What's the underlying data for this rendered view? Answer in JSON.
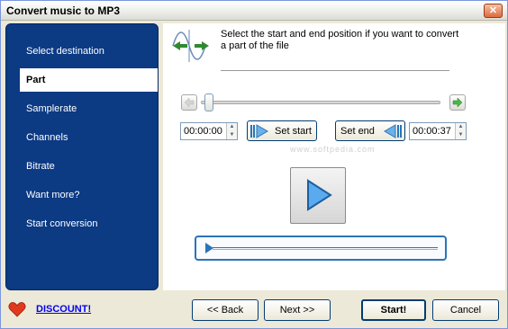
{
  "window": {
    "title": "Convert music to MP3",
    "close_label": "✕"
  },
  "sidebar": {
    "items": [
      {
        "label": "Select destination",
        "active": false
      },
      {
        "label": "Part",
        "active": true
      },
      {
        "label": "Samplerate",
        "active": false
      },
      {
        "label": "Channels",
        "active": false
      },
      {
        "label": "Bitrate",
        "active": false
      },
      {
        "label": "Want more?",
        "active": false
      },
      {
        "label": "Start conversion",
        "active": false
      }
    ]
  },
  "content": {
    "instructions": "Select the start and end position if you want to convert a part of the file",
    "start_time": "00:00:00",
    "end_time": "00:00:37",
    "set_start_label": "Set start",
    "set_end_label": "Set end",
    "watermark": "www.softpedia.com",
    "slider_position": 0,
    "playback_progress": 0
  },
  "footer": {
    "discount_label": "DISCOUNT!",
    "back_label": "<< Back",
    "next_label": "Next >>",
    "start_label": "Start!",
    "cancel_label": "Cancel"
  },
  "colors": {
    "sidebar_bg": "#0c3a83",
    "accent": "#2a74b8",
    "link": "#0000ee"
  }
}
